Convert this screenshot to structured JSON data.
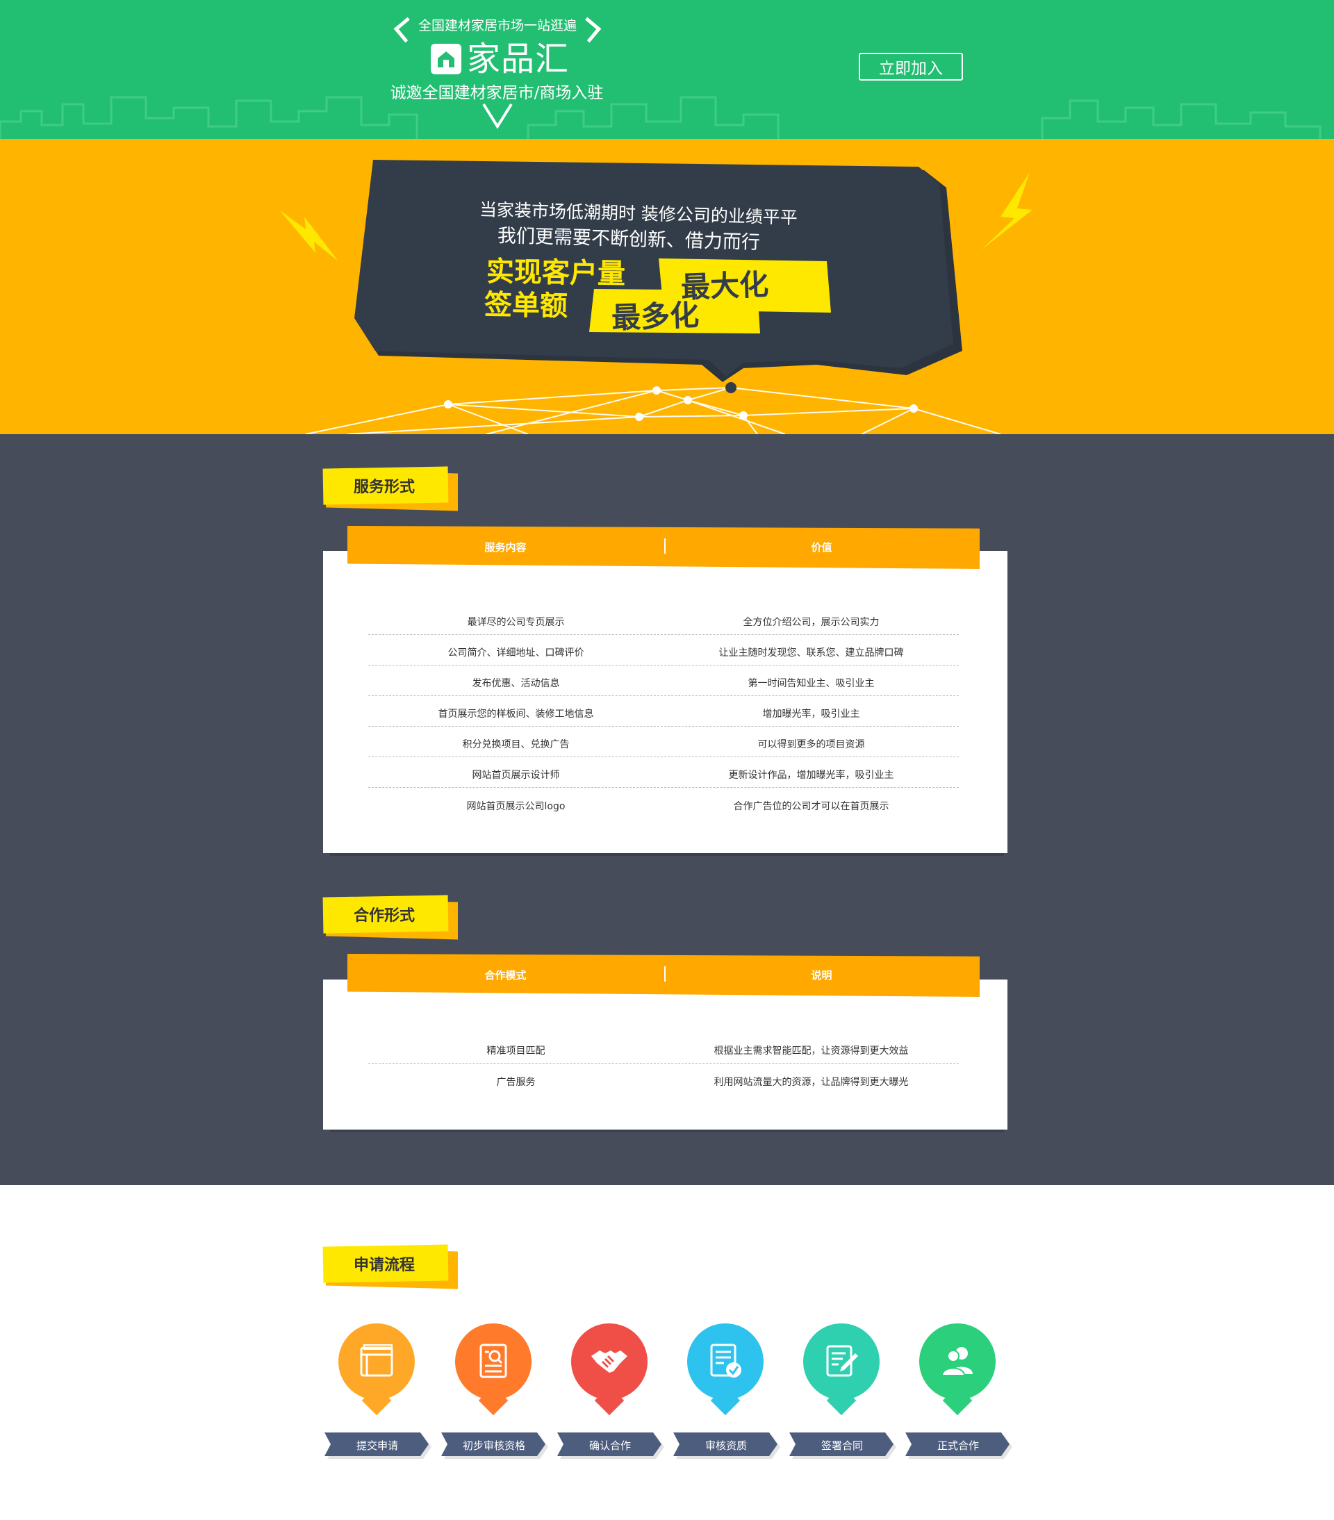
{
  "header": {
    "tagline_top": "全国建材家居市场一站逛遍",
    "logo_text": "家品汇",
    "tagline_bottom": "诚邀全国建材家居市/商场入驻",
    "join_label": "立即加入",
    "logo_icon": "house-icon",
    "bg_color": "#22bf72"
  },
  "banner": {
    "line1": "当家装市场低潮期时  装修公司的业绩平平",
    "line2": "我们更需要不断创新、借力而行",
    "big1": "实现客户量",
    "big2": "签单额",
    "big3": "最大化",
    "big4": "最多化",
    "bg_color": "#ffb400",
    "bubble_color": "#333d4a",
    "accent_color": "#ffe800"
  },
  "service": {
    "section_title": "服务形式",
    "col1": "服务内容",
    "col2": "价值",
    "rows": [
      [
        "最详尽的公司专页展示",
        "全方位介绍公司，展示公司实力"
      ],
      [
        "公司简介、详细地址、口碑评价",
        "让业主随时发现您、联系您、建立品牌口碑"
      ],
      [
        "发布优惠、活动信息",
        "第一时间告知业主、吸引业主"
      ],
      [
        "首页展示您的样板间、装修工地信息",
        "增加曝光率，吸引业主"
      ],
      [
        "积分兑换项目、兑换广告",
        "可以得到更多的项目资源"
      ],
      [
        "网站首页展示设计师",
        "更新设计作品，增加曝光率，吸引业主"
      ],
      [
        "网站首页展示公司logo",
        "合作广告位的公司才可以在首页展示"
      ]
    ]
  },
  "coop": {
    "section_title": "合作形式",
    "col1": "合作模式",
    "col2": "说明",
    "rows": [
      [
        "精准项目匹配",
        "根据业主需求智能匹配，让资源得到更大效益"
      ],
      [
        "广告服务",
        "利用网站流量大的资源，让品牌得到更大曝光"
      ]
    ]
  },
  "process": {
    "section_title": "申请流程",
    "steps": [
      {
        "label": "提交申请",
        "icon": "application-form-icon",
        "color": "#ffa726"
      },
      {
        "label": "初步审核资格",
        "icon": "document-search-icon",
        "color": "#ff7a2a"
      },
      {
        "label": "确认合作",
        "icon": "handshake-icon",
        "color": "#f04f47"
      },
      {
        "label": "审核资质",
        "icon": "verified-document-icon",
        "color": "#2ec3ee"
      },
      {
        "label": "签署合同",
        "icon": "sign-contract-icon",
        "color": "#2fd0b0"
      },
      {
        "label": "正式合作",
        "icon": "partners-icon",
        "color": "#2bcf7c"
      }
    ]
  }
}
